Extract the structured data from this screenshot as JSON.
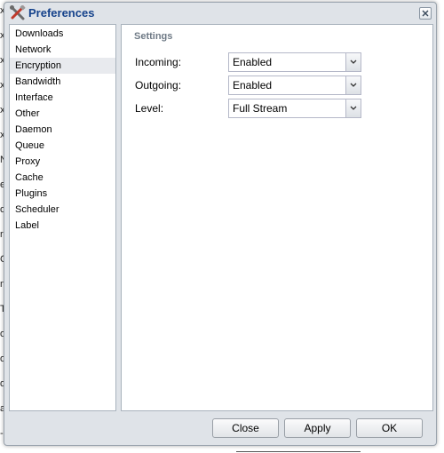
{
  "window": {
    "title": "Preferences",
    "title_icon": "wrench-screwdriver-icon",
    "close_icon": "close-icon"
  },
  "sidebar": {
    "selected_index": 2,
    "items": [
      {
        "label": "Downloads"
      },
      {
        "label": "Network"
      },
      {
        "label": "Encryption"
      },
      {
        "label": "Bandwidth"
      },
      {
        "label": "Interface"
      },
      {
        "label": "Other"
      },
      {
        "label": "Daemon"
      },
      {
        "label": "Queue"
      },
      {
        "label": "Proxy"
      },
      {
        "label": "Cache"
      },
      {
        "label": "Plugins"
      },
      {
        "label": "Scheduler"
      },
      {
        "label": "Label"
      }
    ]
  },
  "settings": {
    "section_title": "Settings",
    "fields": [
      {
        "label": "Incoming:",
        "value": "Enabled"
      },
      {
        "label": "Outgoing:",
        "value": "Enabled"
      },
      {
        "label": "Level:",
        "value": "Full Stream"
      }
    ]
  },
  "footer": {
    "close_label": "Close",
    "apply_label": "Apply",
    "ok_label": "OK"
  },
  "background_fragments": [
    "x",
    "x",
    "x",
    "x",
    "x",
    "x",
    "N",
    "er",
    "o",
    "r",
    "C",
    "ne",
    "T",
    "oo",
    "o",
    "d",
    "au",
    "-"
  ],
  "colors": {
    "title_text": "#15428b",
    "section_title": "#6f7a86",
    "selected_row": "#e8eaee",
    "window_frame": "#dfe3e8"
  }
}
